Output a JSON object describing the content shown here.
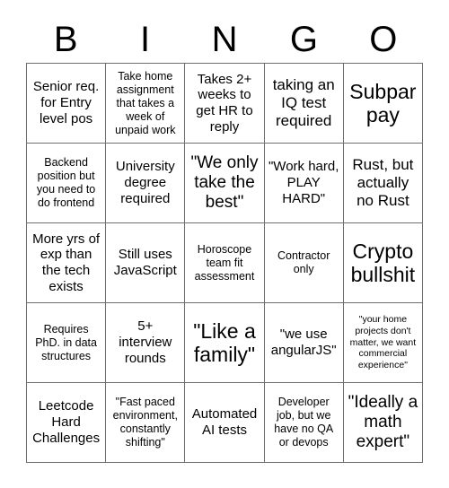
{
  "card": {
    "title": "BINGO",
    "header_letters": [
      "B",
      "I",
      "N",
      "G",
      "O"
    ],
    "grid_size": "5x5",
    "colors": {
      "background": "#ffffff",
      "text": "#000000",
      "grid_line": "#6e6e6e"
    },
    "rows": [
      [
        {
          "text": "Senior req. for Entry level pos",
          "size": "md"
        },
        {
          "text": "Take home assignment that takes a week of unpaid work",
          "size": "sm"
        },
        {
          "text": "Takes 2+ weeks to get HR to reply",
          "size": "md"
        },
        {
          "text": "taking an IQ test required",
          "size": "lg"
        },
        {
          "text": "Subpar pay",
          "size": "xxl"
        }
      ],
      [
        {
          "text": "Backend position but you need to do frontend",
          "size": "sm"
        },
        {
          "text": "University degree required",
          "size": "md"
        },
        {
          "text": "\"We only take the best\"",
          "size": "xl"
        },
        {
          "text": "\"Work hard, PLAY HARD\"",
          "size": "md"
        },
        {
          "text": "Rust, but actually no Rust",
          "size": "lg"
        }
      ],
      [
        {
          "text": "More yrs of exp than the tech exists",
          "size": "md"
        },
        {
          "text": "Still uses JavaScript",
          "size": "md"
        },
        {
          "text": "Horoscope team fit assessment",
          "size": "sm"
        },
        {
          "text": "Contractor only",
          "size": "sm"
        },
        {
          "text": "Crypto bullshit",
          "size": "xxl"
        }
      ],
      [
        {
          "text": "Requires PhD. in data structures",
          "size": "sm"
        },
        {
          "text": "5+ interview rounds",
          "size": "md"
        },
        {
          "text": "\"Like a family\"",
          "size": "xxl"
        },
        {
          "text": "\"we use angularJS\"",
          "size": "md"
        },
        {
          "text": "\"your home projects don't matter, we want commercial experience\"",
          "size": "xs"
        }
      ],
      [
        {
          "text": "Leetcode Hard Challenges",
          "size": "md"
        },
        {
          "text": "\"Fast paced environment, constantly shifting\"",
          "size": "sm"
        },
        {
          "text": "Automated AI tests",
          "size": "md"
        },
        {
          "text": "Developer job, but we have no QA or devops",
          "size": "sm"
        },
        {
          "text": "\"Ideally a math expert\"",
          "size": "xl"
        }
      ]
    ]
  }
}
